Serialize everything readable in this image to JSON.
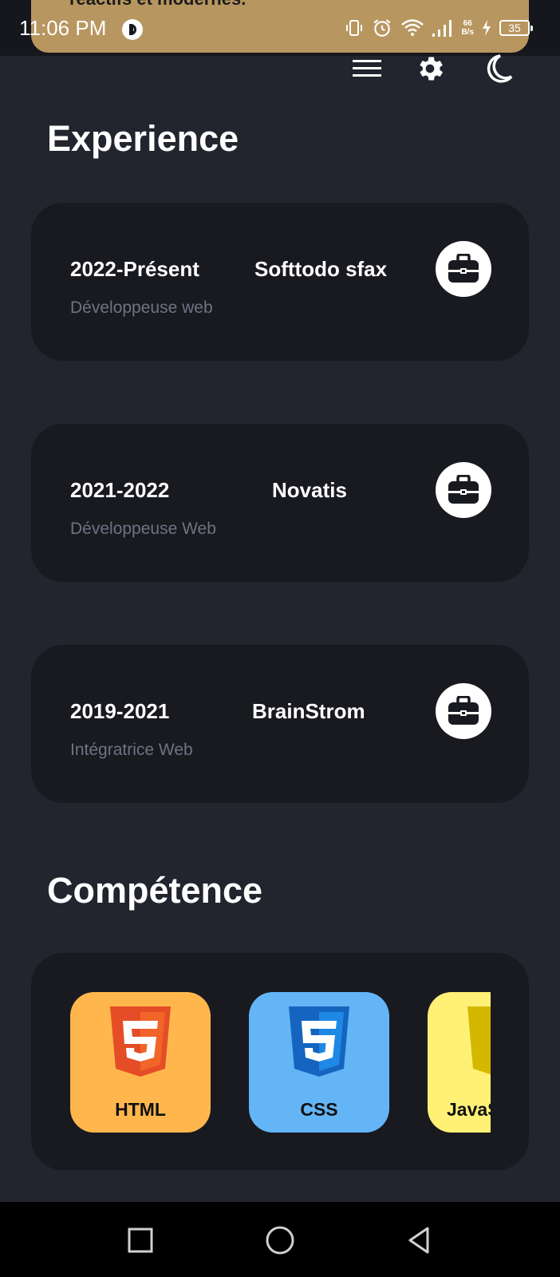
{
  "status_bar": {
    "time": "11:06 PM",
    "net_speed_value": "66",
    "net_speed_unit": "B/s",
    "battery": "35",
    "icons": [
      "vibrate-icon",
      "alarm-icon",
      "wifi-icon",
      "signal-icon",
      "charging-icon",
      "battery-icon"
    ]
  },
  "toast": {
    "text": "réactifs et modernes."
  },
  "top_actions": [
    "menu-icon",
    "settings-icon",
    "moon-icon"
  ],
  "experience": {
    "title": "Experience",
    "items": [
      {
        "period": "2022-Présent",
        "company": "Softtodo sfax",
        "role": "Développeuse web",
        "icon": "briefcase-icon"
      },
      {
        "period": "2021-2022",
        "company": "Novatis",
        "role": "Développeuse Web",
        "icon": "briefcase-icon"
      },
      {
        "period": "2019-2021",
        "company": "BrainStrom",
        "role": "Intégratrice Web",
        "icon": "briefcase-icon"
      }
    ]
  },
  "competence": {
    "title": "Compétence",
    "skills": [
      {
        "label": "HTML",
        "icon": "html5-icon",
        "color": "#ffb74d"
      },
      {
        "label": "CSS",
        "icon": "css3-icon",
        "color": "#64b5f6"
      },
      {
        "label": "JavaScript",
        "icon": "javascript-icon",
        "color": "#fff176"
      }
    ]
  },
  "navigation": [
    "recents-button",
    "home-button",
    "back-button"
  ],
  "colors": {
    "background": "#22242e",
    "card": "#191a20",
    "muted_text": "#6e7282",
    "toast": "#b89660"
  }
}
